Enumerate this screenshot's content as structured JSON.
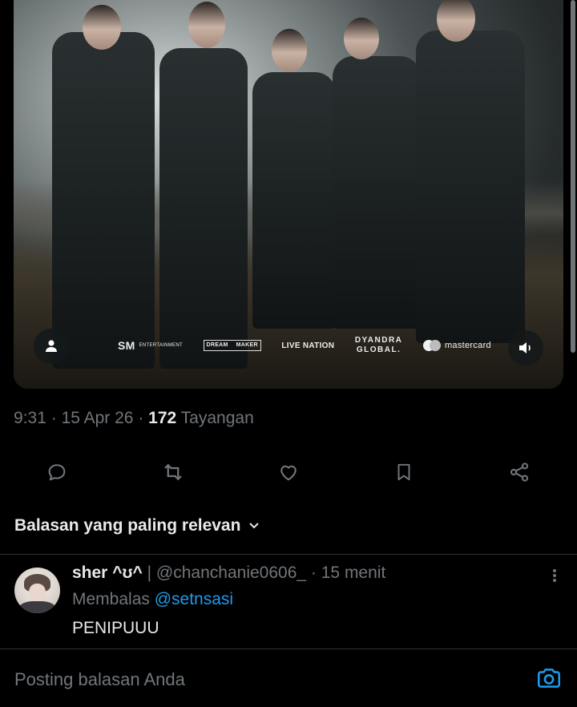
{
  "media": {
    "sponsors": {
      "sm_mark": "SM",
      "sm_text": "ENTERTAINMENT",
      "dreammaker_line1": "DREAM",
      "dreammaker_line2": "MAKER",
      "livenation": "LIVE NATION",
      "dyandra_line1": "DYANDRA",
      "dyandra_line2": "GLOBAL.",
      "mastercard": "mastercard"
    }
  },
  "post": {
    "time": "9:31",
    "date": "15 Apr 26",
    "views_count": "172",
    "views_label": "Tayangan"
  },
  "sort": {
    "label": "Balasan yang paling relevan"
  },
  "reply": {
    "display_name": "sher ^ʊ^",
    "separator": "|",
    "handle": "@chanchanie0606_",
    "time": "15 menit",
    "replying_prefix": "Membalas",
    "replying_to": "@setnsasi",
    "text": "PENIPUUU"
  },
  "composer": {
    "placeholder": "Posting balasan Anda"
  },
  "colors": {
    "accent": "#1d9bf0",
    "secondary_text": "#71767b",
    "primary_text": "#e7e9ea",
    "background": "#000000"
  }
}
